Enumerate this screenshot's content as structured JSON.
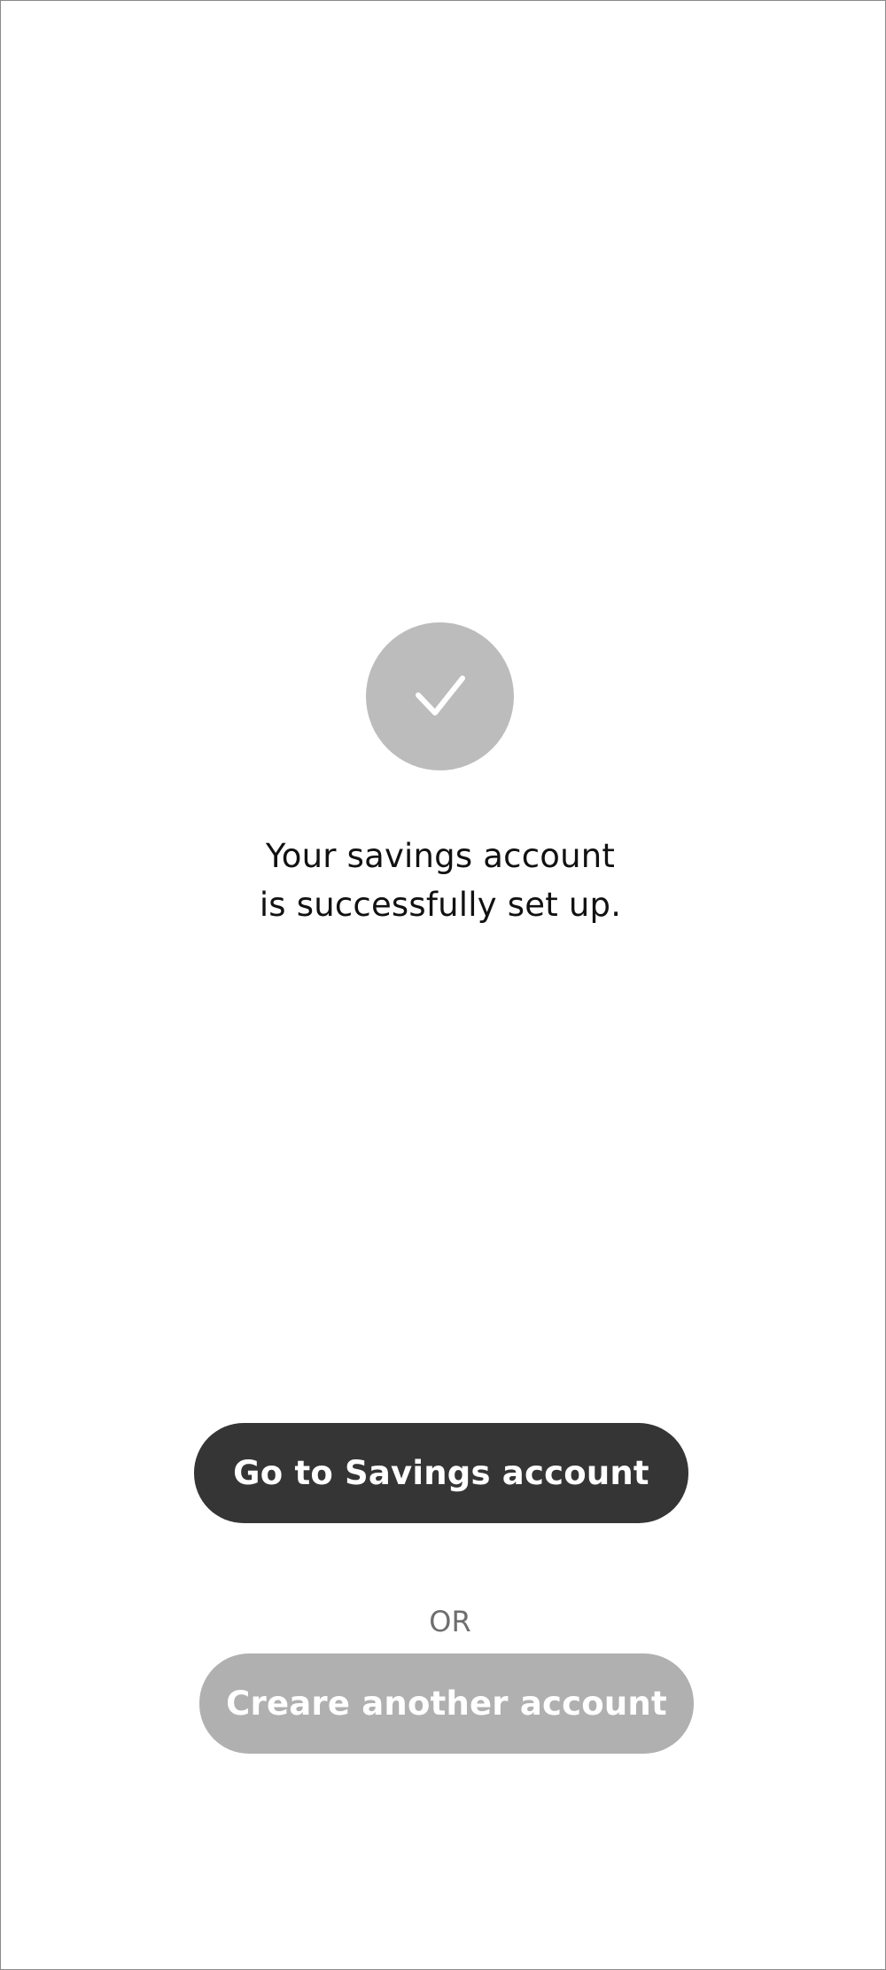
{
  "success": {
    "icon": "checkmark-icon",
    "message_line1": "Your savings account",
    "message_line2": "is successfully set up."
  },
  "actions": {
    "primary_label": "Go to Savings account",
    "divider_label": "OR",
    "secondary_label": "Creare another account"
  },
  "colors": {
    "badge": "#bcbcbd",
    "primary_button": "#353535",
    "secondary_button": "#b0b0b0",
    "divider_text": "#6e6e6e"
  }
}
